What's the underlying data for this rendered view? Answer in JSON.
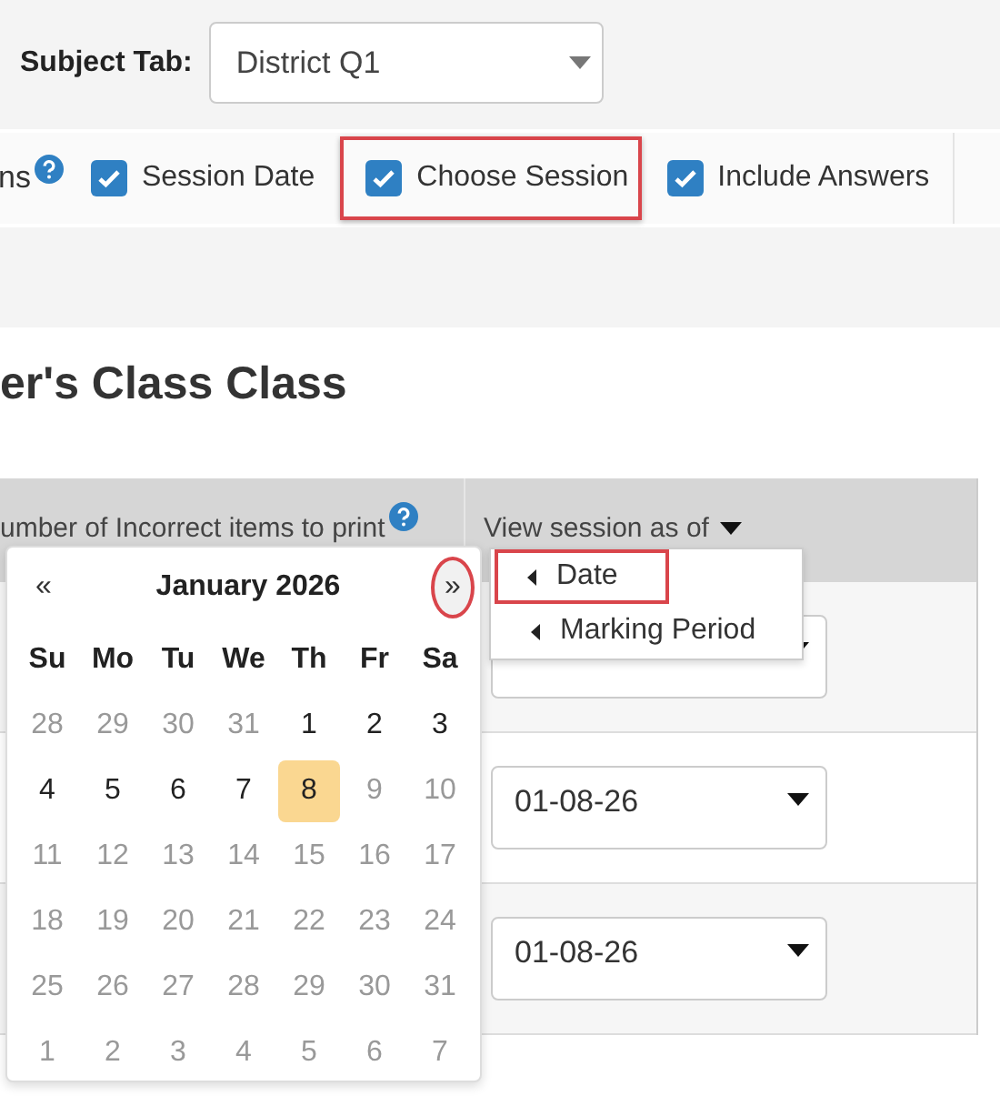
{
  "subject_tab": {
    "label": "Subject Tab:",
    "value": "District Q1"
  },
  "options": {
    "cut_label": "ns",
    "checkboxes": [
      {
        "label": "Session Date",
        "checked": true,
        "highlighted": false
      },
      {
        "label": "Choose Session",
        "checked": true,
        "highlighted": true
      },
      {
        "label": "Include Answers",
        "checked": true,
        "highlighted": false
      }
    ]
  },
  "heading": "er's Class Class",
  "table": {
    "columns": [
      {
        "label": "umber of Incorrect items to print",
        "help": true
      },
      {
        "label": "View session as of",
        "help": false
      }
    ],
    "rows": [
      {
        "date": ""
      },
      {
        "date": "01-08-26"
      },
      {
        "date": "01-08-26"
      }
    ]
  },
  "session_menu": [
    {
      "label": "Date",
      "highlighted": true
    },
    {
      "label": "Marking Period",
      "highlighted": false
    }
  ],
  "calendar": {
    "prev": "«",
    "title": "January 2026",
    "next": "»",
    "next_circled": true,
    "weekdays": [
      "Su",
      "Mo",
      "Tu",
      "We",
      "Th",
      "Fr",
      "Sa"
    ],
    "weeks": [
      [
        {
          "day": "28",
          "disabled": true,
          "selected": false
        },
        {
          "day": "29",
          "disabled": true,
          "selected": false
        },
        {
          "day": "30",
          "disabled": true,
          "selected": false
        },
        {
          "day": "31",
          "disabled": true,
          "selected": false
        },
        {
          "day": "1",
          "disabled": false,
          "selected": false
        },
        {
          "day": "2",
          "disabled": false,
          "selected": false
        },
        {
          "day": "3",
          "disabled": false,
          "selected": false
        }
      ],
      [
        {
          "day": "4",
          "disabled": false,
          "selected": false
        },
        {
          "day": "5",
          "disabled": false,
          "selected": false
        },
        {
          "day": "6",
          "disabled": false,
          "selected": false
        },
        {
          "day": "7",
          "disabled": false,
          "selected": false
        },
        {
          "day": "8",
          "disabled": false,
          "selected": true
        },
        {
          "day": "9",
          "disabled": true,
          "selected": false
        },
        {
          "day": "10",
          "disabled": true,
          "selected": false
        }
      ],
      [
        {
          "day": "11",
          "disabled": true,
          "selected": false
        },
        {
          "day": "12",
          "disabled": true,
          "selected": false
        },
        {
          "day": "13",
          "disabled": true,
          "selected": false
        },
        {
          "day": "14",
          "disabled": true,
          "selected": false
        },
        {
          "day": "15",
          "disabled": true,
          "selected": false
        },
        {
          "day": "16",
          "disabled": true,
          "selected": false
        },
        {
          "day": "17",
          "disabled": true,
          "selected": false
        }
      ],
      [
        {
          "day": "18",
          "disabled": true,
          "selected": false
        },
        {
          "day": "19",
          "disabled": true,
          "selected": false
        },
        {
          "day": "20",
          "disabled": true,
          "selected": false
        },
        {
          "day": "21",
          "disabled": true,
          "selected": false
        },
        {
          "day": "22",
          "disabled": true,
          "selected": false
        },
        {
          "day": "23",
          "disabled": true,
          "selected": false
        },
        {
          "day": "24",
          "disabled": true,
          "selected": false
        }
      ],
      [
        {
          "day": "25",
          "disabled": true,
          "selected": false
        },
        {
          "day": "26",
          "disabled": true,
          "selected": false
        },
        {
          "day": "27",
          "disabled": true,
          "selected": false
        },
        {
          "day": "28",
          "disabled": true,
          "selected": false
        },
        {
          "day": "29",
          "disabled": true,
          "selected": false
        },
        {
          "day": "30",
          "disabled": true,
          "selected": false
        },
        {
          "day": "31",
          "disabled": true,
          "selected": false
        }
      ],
      [
        {
          "day": "1",
          "disabled": true,
          "selected": false
        },
        {
          "day": "2",
          "disabled": true,
          "selected": false
        },
        {
          "day": "3",
          "disabled": true,
          "selected": false
        },
        {
          "day": "4",
          "disabled": true,
          "selected": false
        },
        {
          "day": "5",
          "disabled": true,
          "selected": false
        },
        {
          "day": "6",
          "disabled": true,
          "selected": false
        },
        {
          "day": "7",
          "disabled": true,
          "selected": false
        }
      ]
    ]
  }
}
